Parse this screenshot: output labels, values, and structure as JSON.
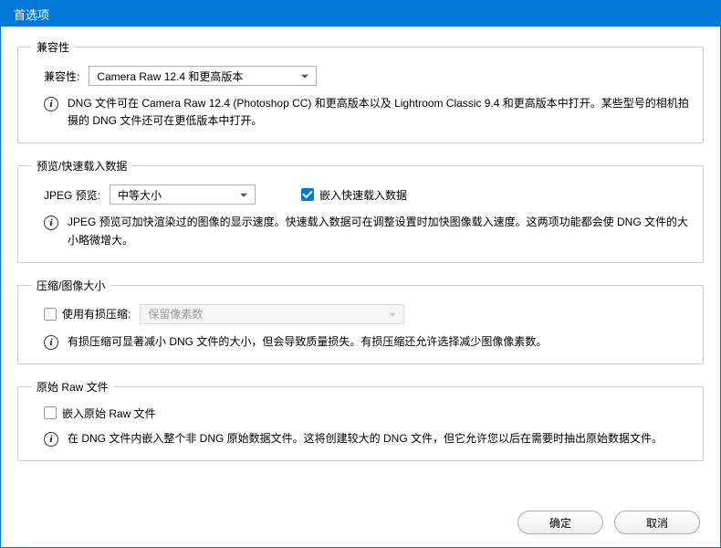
{
  "title": "首选项",
  "compat": {
    "legend": "兼容性",
    "label": "兼容性:",
    "select": "Camera Raw 12.4 和更高版本",
    "info": "DNG 文件可在 Camera Raw 12.4 (Photoshop CC) 和更高版本以及 Lightroom Classic 9.4 和更高版本中打开。某些型号的相机拍摄的 DNG 文件还可在更低版本中打开。"
  },
  "preview": {
    "legend": "预览/快速载入数据",
    "jpegLabel": "JPEG 预览:",
    "jpegSelect": "中等大小",
    "embedLabel": "嵌入快速载入数据",
    "info": "JPEG 预览可加快渲染过的图像的显示速度。快速载入数据可在调整设置时加快图像载入速度。这两项功能都会使 DNG 文件的大小略微增大。"
  },
  "compress": {
    "legend": "压缩/图像大小",
    "lossyLabel": "使用有损压缩:",
    "lossySelect": "保留像素数",
    "info": "有损压缩可显著减小 DNG 文件的大小，但会导致质量损失。有损压缩还允许选择减少图像像素数。"
  },
  "raw": {
    "legend": "原始 Raw 文件",
    "embedLabel": "嵌入原始 Raw 文件",
    "info": "在 DNG 文件内嵌入整个非 DNG 原始数据文件。这将创建较大的 DNG 文件，但它允许您以后在需要时抽出原始数据文件。"
  },
  "buttons": {
    "ok": "确定",
    "cancel": "取消"
  }
}
